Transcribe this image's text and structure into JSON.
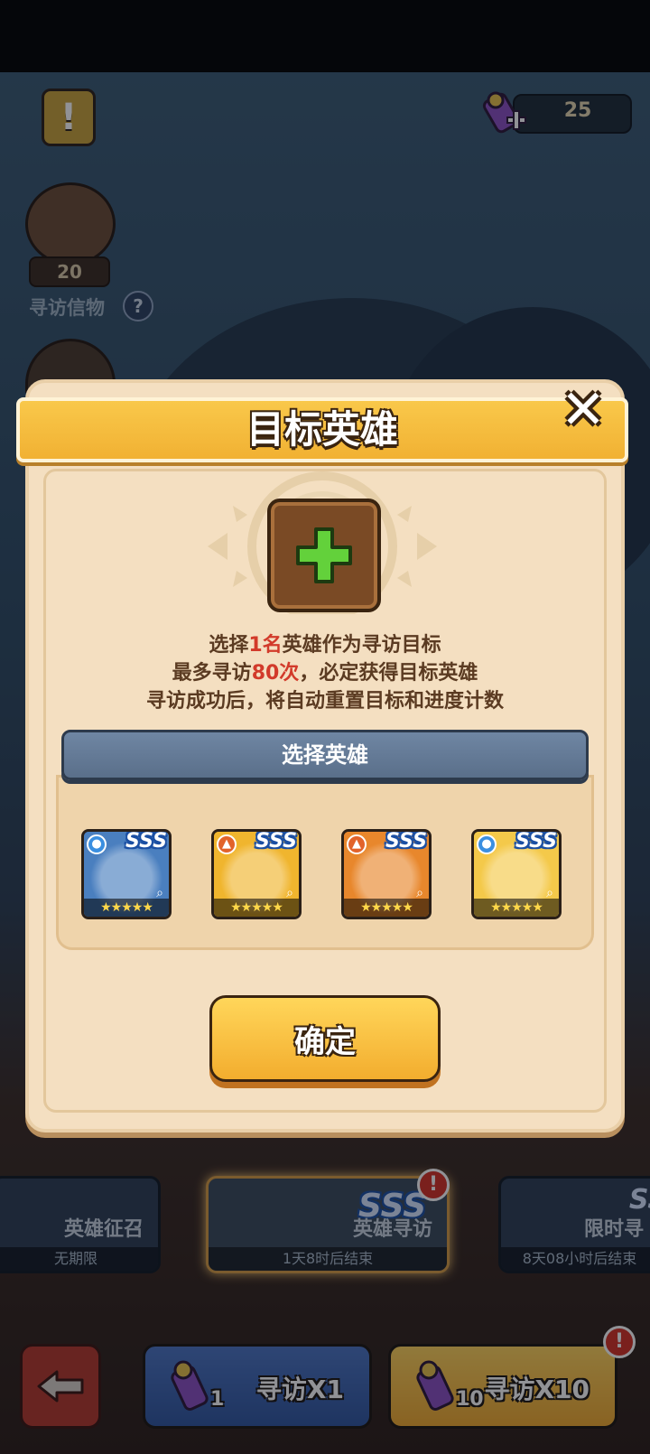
{
  "top_bar": {
    "alert_label": "!",
    "currency_value": "25"
  },
  "side": {
    "shell_count": "20",
    "visit_item_label": "寻访信物",
    "help_label": "?"
  },
  "modal": {
    "title": "目标英雄",
    "close_label": "✕",
    "desc_line1_prefix": "选择",
    "desc_line1_highlight": "1名",
    "desc_line1_suffix": "英雄作为寻访目标",
    "desc_line2_prefix": "最多寻访",
    "desc_line2_highlight": "80次",
    "desc_line2_suffix": "，必定获得目标英雄",
    "desc_line3": "寻访成功后，将自动重置目标和进度计数",
    "select_header": "选择英雄",
    "heroes": [
      {
        "rank": "SSS",
        "element": "water",
        "stars": "★★★★★",
        "accent": "#3b8fe0",
        "bg": "#4a7fbf"
      },
      {
        "rank": "SSS",
        "element": "fire",
        "stars": "★★★★★",
        "accent": "#e2632b",
        "bg": "#f0b52e"
      },
      {
        "rank": "SSS",
        "element": "fire",
        "stars": "★★★★★",
        "accent": "#e2632b",
        "bg": "#e8872c"
      },
      {
        "rank": "SSS",
        "element": "water",
        "stars": "★★★★★",
        "accent": "#3b8fe0",
        "bg": "#f4c94a"
      }
    ],
    "confirm_label": "确定"
  },
  "banners": [
    {
      "name": "英雄征召",
      "time": "无期限"
    },
    {
      "name": "英雄寻访",
      "time": "1天8时后结束",
      "rank": "SSS",
      "badge": "!"
    },
    {
      "name": "限时寻",
      "time": "8天08小时后结束",
      "rank": "SS"
    }
  ],
  "actions": {
    "single_label": "寻访X1",
    "single_count": "1",
    "multi_label": "寻访X10",
    "multi_count": "10",
    "multi_badge": "!"
  }
}
